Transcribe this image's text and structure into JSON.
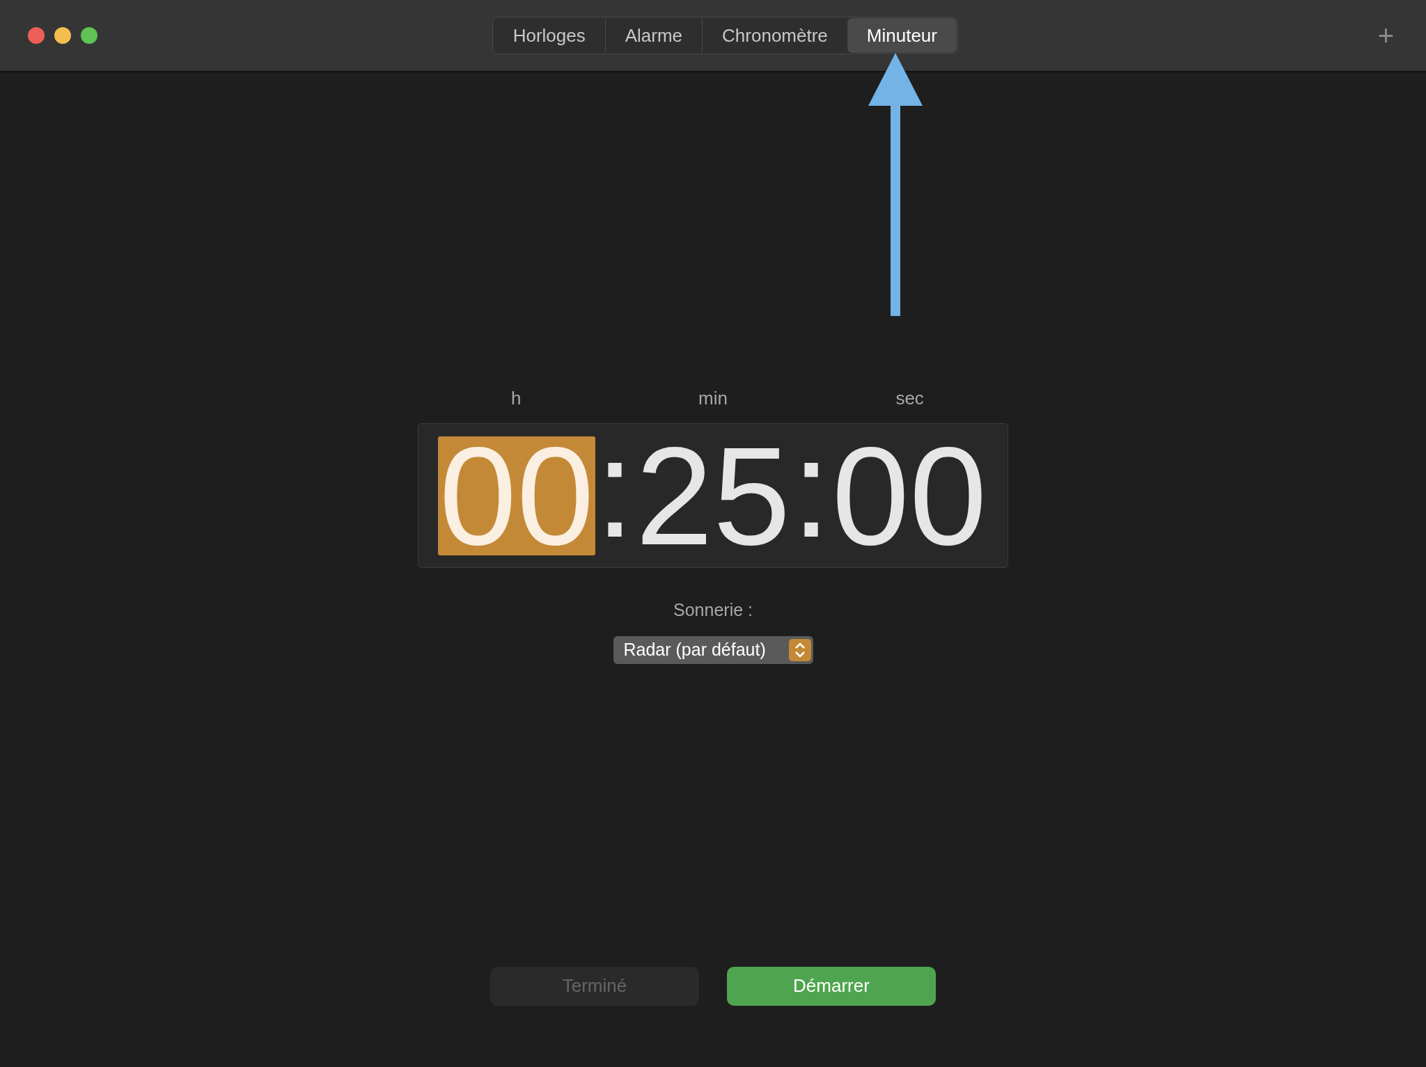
{
  "window": {
    "add_button": "+"
  },
  "tabs": [
    {
      "label": "Horloges",
      "selected": false
    },
    {
      "label": "Alarme",
      "selected": false
    },
    {
      "label": "Chronomètre",
      "selected": false
    },
    {
      "label": "Minuteur",
      "selected": true
    }
  ],
  "timer": {
    "units": [
      "h",
      "min",
      "sec"
    ],
    "fields": [
      {
        "value": "00",
        "selected": true
      },
      {
        "value": "25",
        "selected": false
      },
      {
        "value": "00",
        "selected": false
      }
    ],
    "separator": ":"
  },
  "sound": {
    "label": "Sonnerie :",
    "value": "Radar (par défaut)"
  },
  "buttons": [
    {
      "label": "Terminé",
      "kind": "secondary",
      "disabled": true
    },
    {
      "label": "Démarrer",
      "kind": "primary",
      "disabled": false
    }
  ]
}
